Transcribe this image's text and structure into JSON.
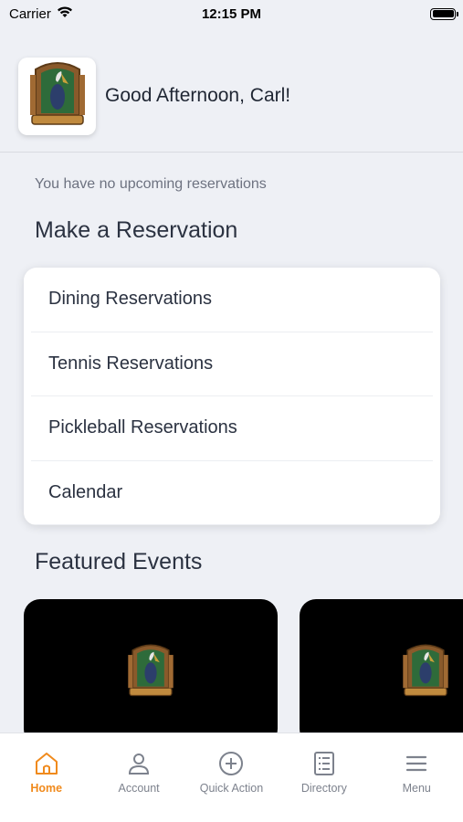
{
  "status_bar": {
    "carrier": "Carrier",
    "time": "12:15 PM"
  },
  "header": {
    "greeting": "Good Afternoon, Carl!",
    "logo_icon": "pelican-marsh-crest-logo"
  },
  "reservations": {
    "empty_message": "You have no upcoming reservations",
    "section_title": "Make a Reservation",
    "items": [
      {
        "label": "Dining Reservations"
      },
      {
        "label": "Tennis Reservations"
      },
      {
        "label": "Pickleball Reservations"
      },
      {
        "label": "Calendar"
      }
    ]
  },
  "events": {
    "section_title": "Featured Events"
  },
  "tab_bar": {
    "active_color": "#f08a1c",
    "tabs": [
      {
        "label": "Home",
        "icon": "home-icon",
        "active": true
      },
      {
        "label": "Account",
        "icon": "user-icon",
        "active": false
      },
      {
        "label": "Quick Action",
        "icon": "plus-circle-icon",
        "active": false
      },
      {
        "label": "Directory",
        "icon": "list-icon",
        "active": false
      },
      {
        "label": "Menu",
        "icon": "menu-icon",
        "active": false
      }
    ]
  }
}
